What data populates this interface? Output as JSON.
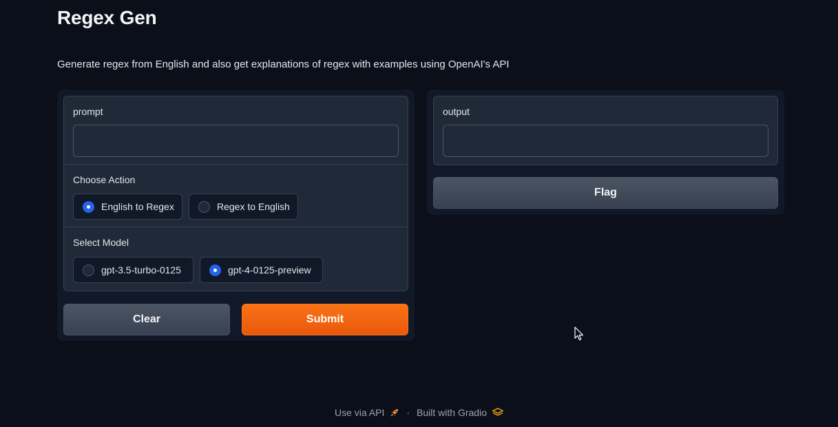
{
  "header": {
    "title": "Regex Gen",
    "description": "Generate regex from English and also get explanations of regex with examples using OpenAI's API"
  },
  "prompt": {
    "label": "prompt",
    "value": "",
    "placeholder": ""
  },
  "action": {
    "label": "Choose Action",
    "options": [
      {
        "label": "English to Regex",
        "checked": true
      },
      {
        "label": "Regex to English",
        "checked": false
      }
    ]
  },
  "model": {
    "label": "Select Model",
    "options": [
      {
        "label": "gpt-3.5-turbo-0125",
        "checked": false
      },
      {
        "label": "gpt-4-0125-preview",
        "checked": true
      }
    ]
  },
  "buttons": {
    "clear": "Clear",
    "submit": "Submit",
    "flag": "Flag"
  },
  "output": {
    "label": "output",
    "value": ""
  },
  "footer": {
    "api_link": "Use via API",
    "separator": "·",
    "built_with": "Built with Gradio",
    "api_icon": "rocket-icon",
    "gradio_icon": "gradio-logo-icon"
  },
  "colors": {
    "background": "#0b0f19",
    "panel": "#111827",
    "block": "#1f2937",
    "accent": "#f97316",
    "radio_checked": "#2563eb"
  }
}
